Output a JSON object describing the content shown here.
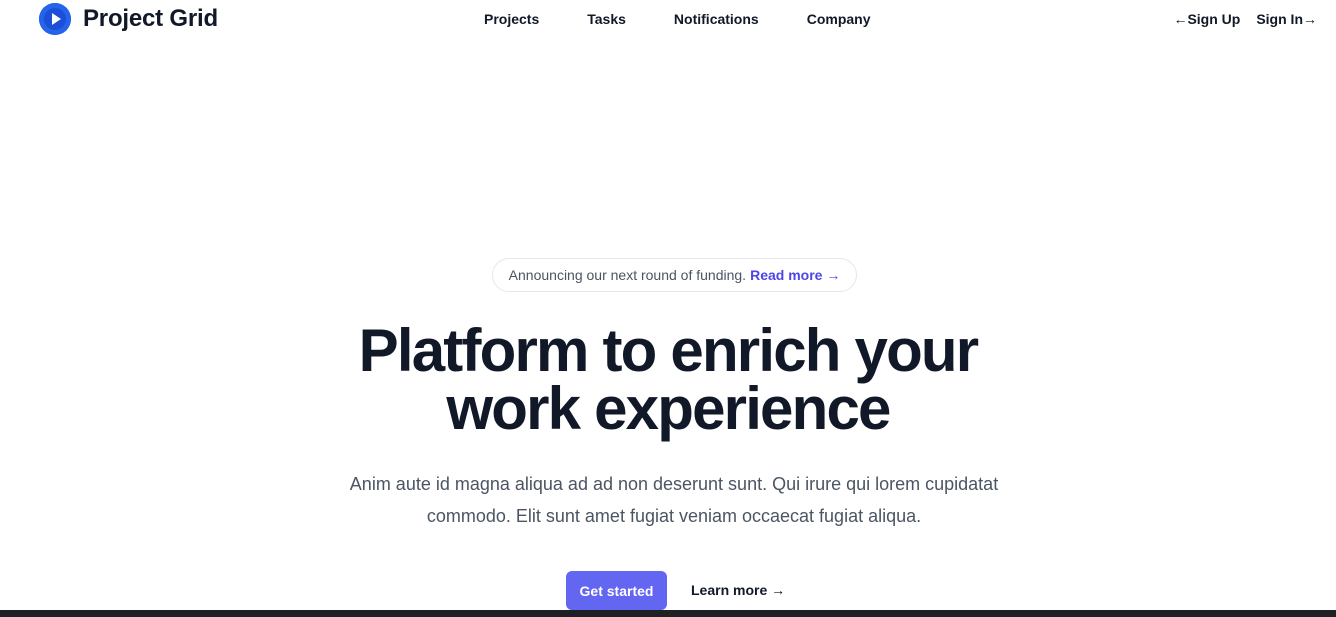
{
  "brand": {
    "name": "Project Grid",
    "logo_icon": "play-circle-icon",
    "logo_color": "#2563eb"
  },
  "nav": {
    "items": [
      {
        "label": "Projects"
      },
      {
        "label": "Tasks"
      },
      {
        "label": "Notifications"
      },
      {
        "label": "Company"
      }
    ]
  },
  "auth": {
    "signup_label": "←Sign Up",
    "signin_label": "Sign In→"
  },
  "announcement": {
    "text": "Announcing our next round of funding.",
    "link_label": "Read more →",
    "link_color": "#4f46e5"
  },
  "hero": {
    "title_line1": "Platform to enrich your",
    "title_line2": "work experience",
    "description": "Anim aute id magna aliqua ad ad non deserunt sunt. Qui irure qui lorem cupidatat commodo. Elit sunt amet fugiat veniam occaecat fugiat aliqua."
  },
  "actions": {
    "primary_label": "Get started",
    "primary_color": "#6366f1",
    "secondary_label": "Learn more →"
  }
}
